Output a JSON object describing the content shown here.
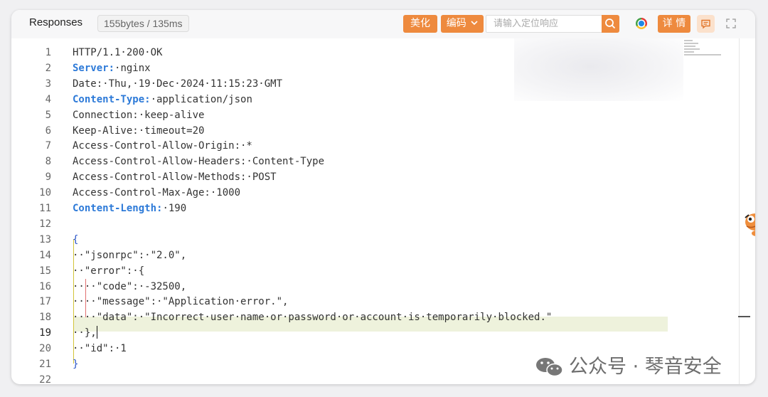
{
  "toolbar": {
    "title": "Responses",
    "meta": "155bytes / 135ms",
    "beautify_label": "美化",
    "encoding_label": "编码",
    "search_placeholder": "请输入定位响应",
    "details_label": "详 情"
  },
  "colors": {
    "accent": "#ee8a3e",
    "header_key": "#2d7ad8",
    "active_line": "#eef2dc"
  },
  "icons": [
    "chevron-down-icon",
    "search-icon",
    "chrome-icon",
    "comment-icon",
    "expand-icon",
    "mascot-icon",
    "wechat-icon"
  ],
  "editor": {
    "active_line": 19,
    "lines": [
      {
        "n": "1",
        "text": "HTTP/1.1·200·OK"
      },
      {
        "n": "2",
        "key": "Server:",
        "text": "·nginx"
      },
      {
        "n": "3",
        "text": "Date:·Thu,·19·Dec·2024·11:15:23·GMT"
      },
      {
        "n": "4",
        "key": "Content-Type:",
        "text": "·application/json"
      },
      {
        "n": "5",
        "text": "Connection:·keep-alive"
      },
      {
        "n": "6",
        "text": "Keep-Alive:·timeout=20"
      },
      {
        "n": "7",
        "text": "Access-Control-Allow-Origin:·*"
      },
      {
        "n": "8",
        "text": "Access-Control-Allow-Headers:·Content-Type"
      },
      {
        "n": "9",
        "text": "Access-Control-Allow-Methods:·POST"
      },
      {
        "n": "10",
        "text": "Access-Control-Max-Age:·1000"
      },
      {
        "n": "11",
        "key": "Content-Length:",
        "text": "·190"
      },
      {
        "n": "12",
        "text": ""
      },
      {
        "n": "13",
        "text": "{"
      },
      {
        "n": "14",
        "text": "··\"jsonrpc\":·\"2.0\","
      },
      {
        "n": "15",
        "text": "··\"error\":·{"
      },
      {
        "n": "16",
        "text": "····\"code\":·-32500,"
      },
      {
        "n": "17",
        "text": "····\"message\":·\"Application·error.\","
      },
      {
        "n": "18",
        "text": "····\"data\":·\"Incorrect·user·name·or·password·or·account·is·temporarily·blocked.\""
      },
      {
        "n": "19",
        "text": "··},"
      },
      {
        "n": "20",
        "text": "··\"id\":·1"
      },
      {
        "n": "21",
        "text": "}"
      },
      {
        "n": "22",
        "text": ""
      }
    ]
  },
  "watermark": "公众号 · 琴音安全"
}
